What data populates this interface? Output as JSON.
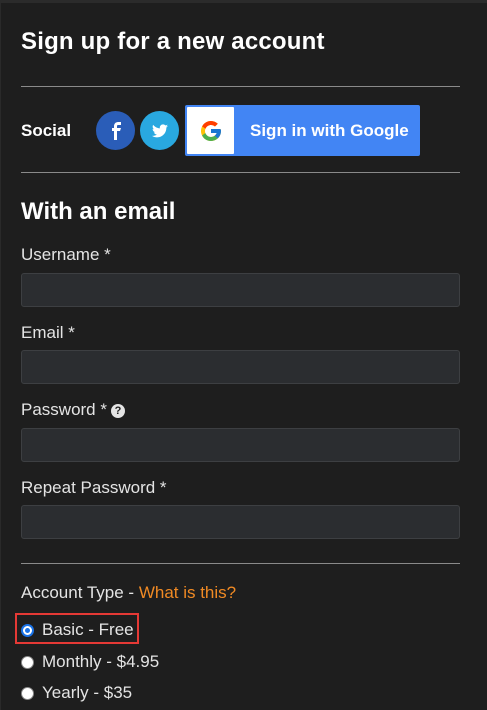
{
  "page": {
    "title": "Sign up for a new account",
    "social": {
      "label": "Social",
      "facebook_icon": "facebook-icon",
      "twitter_icon": "twitter-icon",
      "google_button_label": "Sign in with Google"
    },
    "email_section_title": "With an email",
    "fields": {
      "username": {
        "label": "Username *",
        "value": ""
      },
      "email": {
        "label": "Email *",
        "value": ""
      },
      "password": {
        "label": "Password *",
        "value": ""
      },
      "repeat_password": {
        "label": "Repeat Password *",
        "value": ""
      }
    },
    "account_type": {
      "label": "Account Type - ",
      "help_link": "What is this?",
      "options": [
        {
          "label": "Basic - Free",
          "selected": true
        },
        {
          "label": "Monthly - $4.95",
          "selected": false
        },
        {
          "label": "Yearly - $35",
          "selected": false
        }
      ]
    }
  },
  "colors": {
    "background": "#1e1e1e",
    "google_blue": "#4285f4",
    "facebook_blue": "#2a5db8",
    "twitter_blue": "#29a8e0",
    "link_orange": "#f08a24",
    "highlight_red": "#e53935"
  }
}
